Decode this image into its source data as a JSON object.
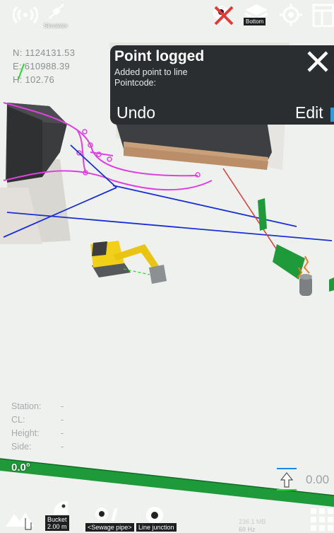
{
  "top_bar": {
    "radio_label": "",
    "simulator_label": "Simulator",
    "layer_label": "Bottom"
  },
  "coordinates": {
    "north": "N: 1124131.53",
    "east": "E: 610988.39",
    "height": "H: 102.76"
  },
  "toast": {
    "title": "Point logged",
    "line1": "Added point to line",
    "line2": "Pointcode:",
    "undo_label": "Undo",
    "edit_label": "Edit"
  },
  "info_panel": {
    "rows": [
      {
        "label": "Station:",
        "value": "-"
      },
      {
        "label": "CL:",
        "value": "-"
      },
      {
        "label": "Height:",
        "value": "-"
      },
      {
        "label": "Side:",
        "value": "-"
      }
    ]
  },
  "angle_readout": "0.0°",
  "offset_readout": "0.00",
  "bottom_bar": {
    "bucket_label_1": "Bucket",
    "bucket_label_2": "2.00 m",
    "code_label": "<Sewage pipe>",
    "junction_label": "Line junction",
    "memory_label": "236.1 MB",
    "fps_label": "60 Hz"
  },
  "colors": {
    "accent_red": "#e53935",
    "toast_bg": "#2b2e31",
    "design_line_magenta": "#e040e0",
    "design_line_blue": "#1a2fd6",
    "pipe_green": "#1f9a3a",
    "excavator_yellow": "#f2d019"
  }
}
